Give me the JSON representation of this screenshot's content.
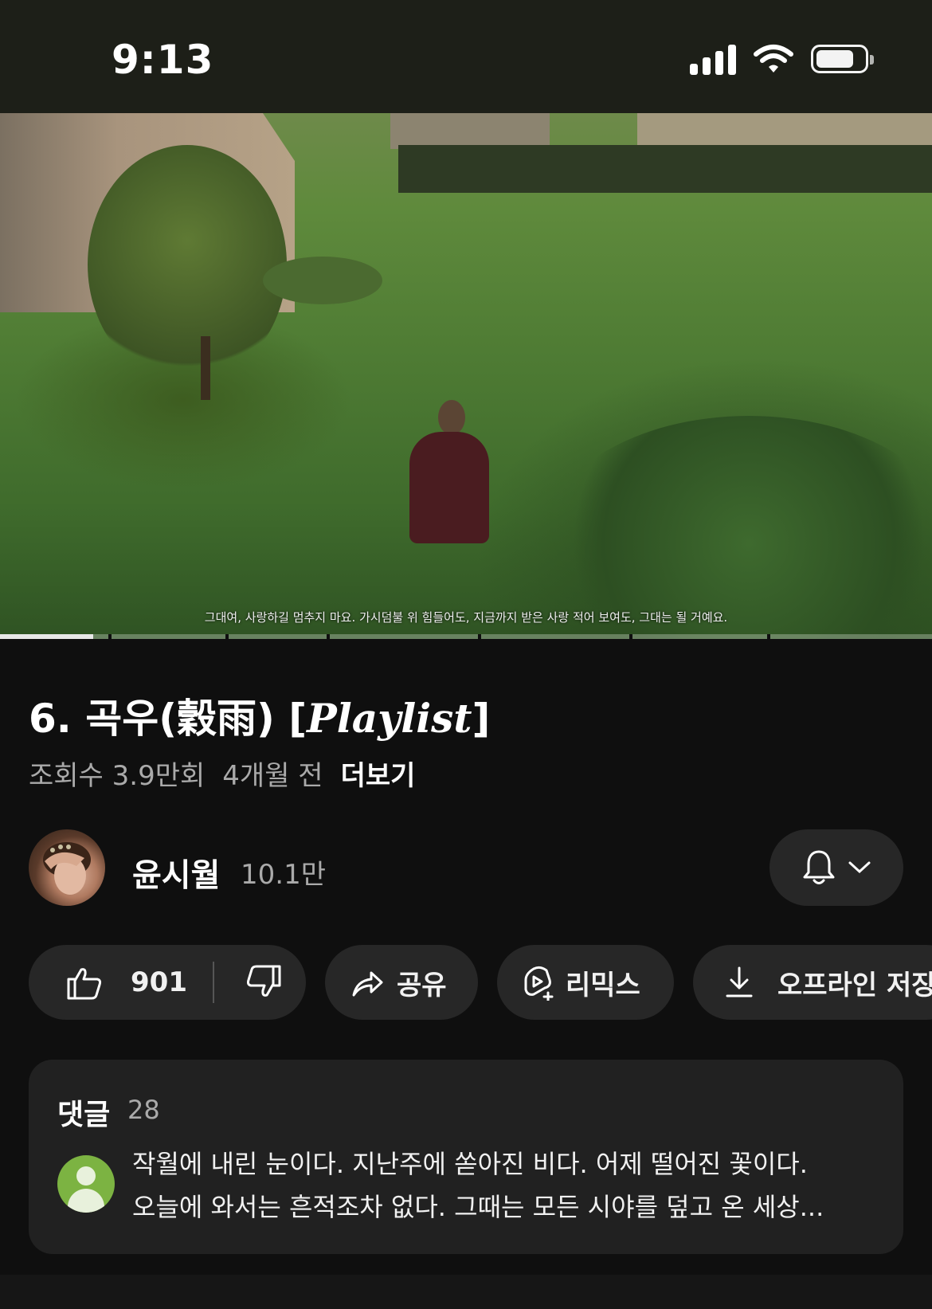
{
  "status_bar": {
    "time": "9:13",
    "battery_percent": 75
  },
  "video": {
    "caption": "그대여, 사랑하길 멈추지 마요. 가시덤불 위 힘들어도, 지금까지 받은 사랑 적어 보여도, 그대는 될 거예요.",
    "progress_fraction": 0.1
  },
  "title": {
    "prefix": "6. 곡우(穀雨) [",
    "playlist": "Playlist",
    "suffix": "]"
  },
  "meta": {
    "views": "조회수 3.9만회",
    "age": "4개월 전",
    "more": "더보기"
  },
  "channel": {
    "name": "윤시월",
    "subscribers": "10.1만"
  },
  "actions": {
    "like_count": "901",
    "share_label": "공유",
    "remix_label": "리믹스",
    "offline_label": "오프라인 저장"
  },
  "comments": {
    "title": "댓글",
    "count": "28",
    "preview_line1": "작월에 내린 눈이다. 지난주에 쏟아진 비다. 어제 떨어진 꽃이다.",
    "preview_line2": "오늘에 와서는 흔적조차 없다. 그때는 모든 시야를 덮고 온 세상..."
  }
}
